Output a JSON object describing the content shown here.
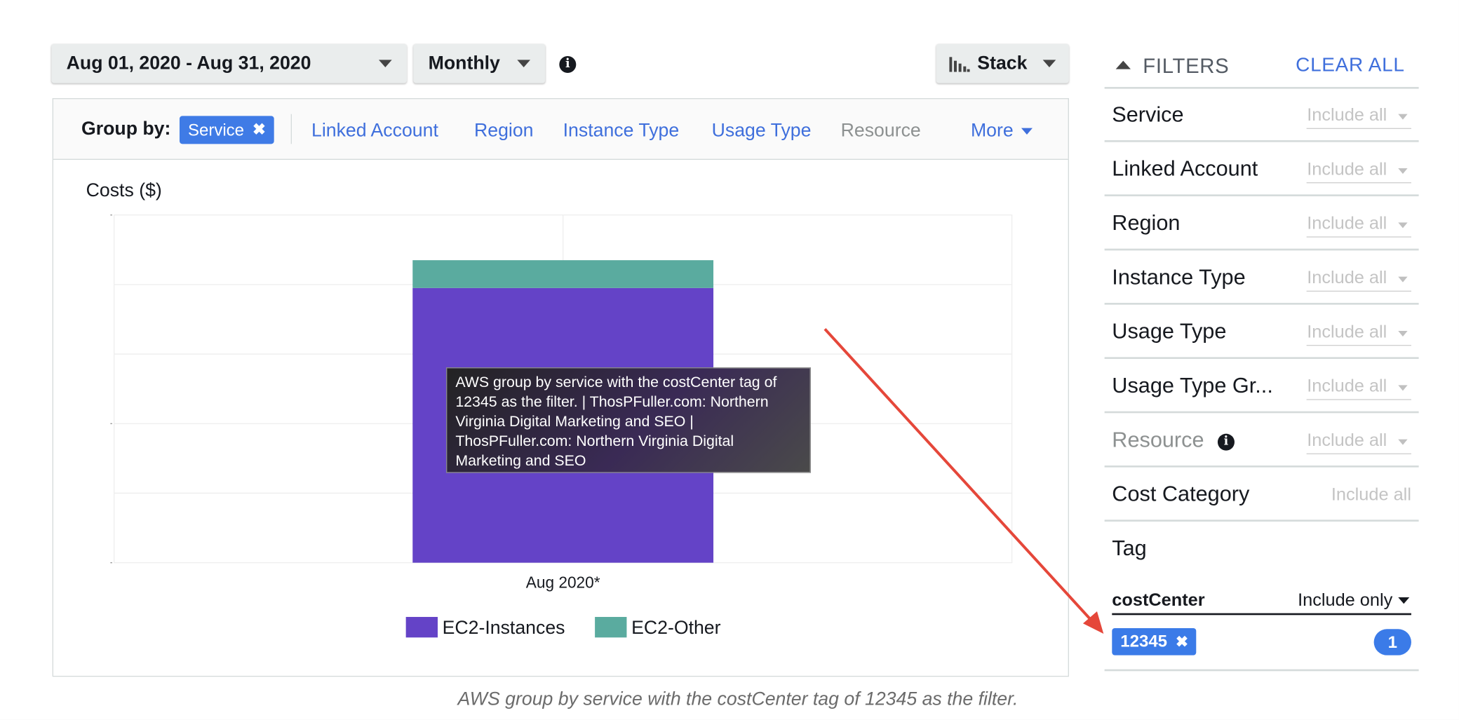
{
  "toolbar": {
    "date_range": "Aug 01, 2020 - Aug 31, 2020",
    "granularity": "Monthly",
    "chart_style": "Stack"
  },
  "group_by": {
    "label": "Group by:",
    "selected": "Service",
    "options": [
      "Linked Account",
      "Region",
      "Instance Type",
      "Usage Type"
    ],
    "disabled_option": "Resource",
    "more": "More"
  },
  "chart_data": {
    "type": "bar",
    "stacked": true,
    "ylabel": "Costs ($)",
    "categories": [
      "Aug 2020*"
    ],
    "series": [
      {
        "name": "EC2-Instances",
        "values": [
          0.79
        ],
        "color": "#6443c7"
      },
      {
        "name": "EC2-Other",
        "values": [
          0.08
        ],
        "color": "#5aab9f"
      }
    ],
    "ylim": [
      0,
      1
    ],
    "grid": true,
    "legend": "bottom"
  },
  "tooltip": {
    "text": "AWS group by service with the costCenter tag of 12345 as the filter. | ThosPFuller.com: Northern Virginia Digital Marketing and SEO | ThosPFuller.com: Northern Virginia Digital Marketing and SEO"
  },
  "filters": {
    "title": "FILTERS",
    "clear_all": "CLEAR ALL",
    "rows": [
      {
        "label": "Service",
        "value": "Include all"
      },
      {
        "label": "Linked Account",
        "value": "Include all"
      },
      {
        "label": "Region",
        "value": "Include all"
      },
      {
        "label": "Instance Type",
        "value": "Include all"
      },
      {
        "label": "Usage Type",
        "value": "Include all"
      },
      {
        "label": "Usage Type Gr...",
        "value": "Include all"
      },
      {
        "label": "Resource",
        "value": "Include all"
      },
      {
        "label": "Cost Category",
        "value": "Include all"
      }
    ],
    "tag": {
      "label": "Tag",
      "key": "costCenter",
      "mode": "Include only",
      "value_chip": "12345",
      "count": "1"
    }
  },
  "caption": "AWS group by service with the costCenter tag of 12345 as the filter.",
  "colors": {
    "accent": "#3f6fdc",
    "chip": "#3b7be8",
    "arrow": "#e5473a"
  }
}
